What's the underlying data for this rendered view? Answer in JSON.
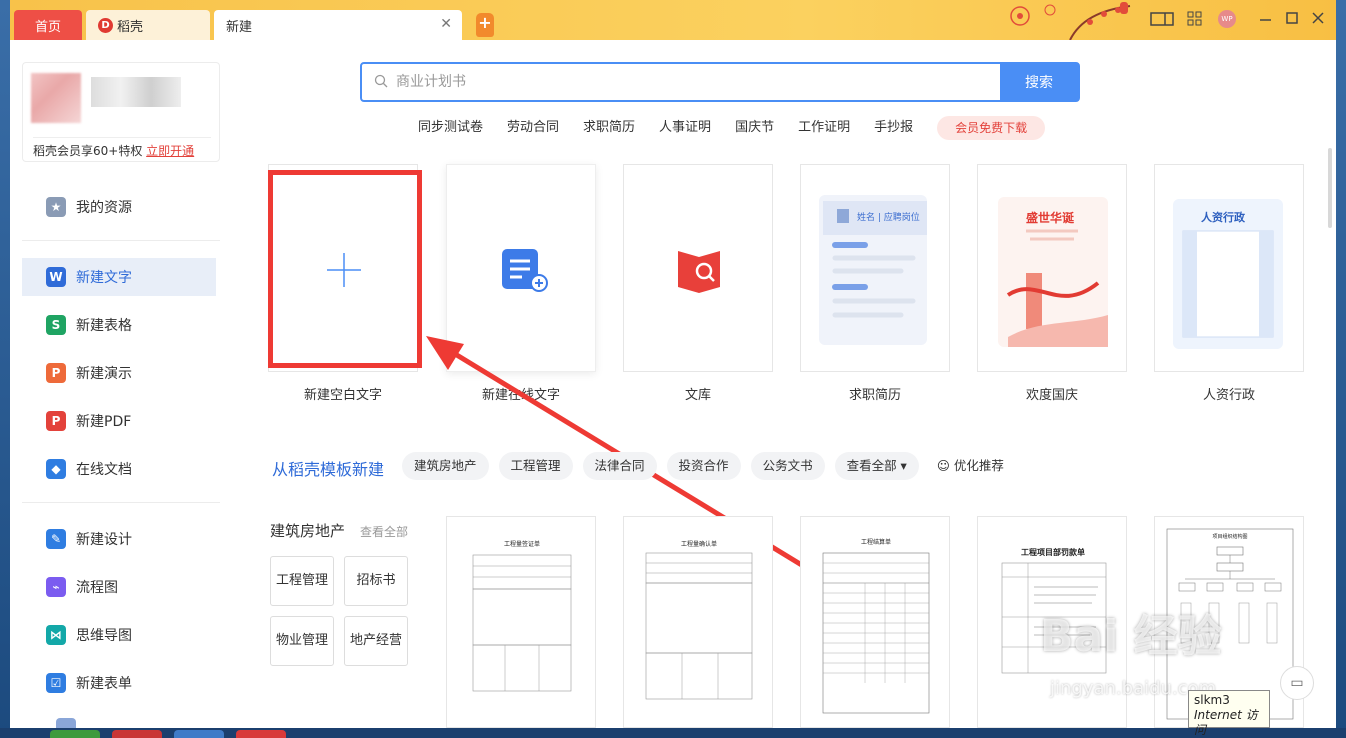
{
  "tabs": [
    {
      "label": "首页"
    },
    {
      "label": "稻壳"
    },
    {
      "label": "新建"
    }
  ],
  "user": {
    "vip_text": "稻壳会员享60+特权",
    "vip_link": "立即开通"
  },
  "sidebar": {
    "items": [
      {
        "label": "我的资源",
        "icon": "star-icon",
        "color": "#8a9bb5"
      },
      {
        "label": "新建文字",
        "icon": "writer-icon",
        "color": "#2f6bd8"
      },
      {
        "label": "新建表格",
        "icon": "sheet-icon",
        "color": "#1fa463"
      },
      {
        "label": "新建演示",
        "icon": "presentation-icon",
        "color": "#ee6a3a"
      },
      {
        "label": "新建PDF",
        "icon": "pdf-icon",
        "color": "#e3423b"
      },
      {
        "label": "在线文档",
        "icon": "cloud-doc-icon",
        "color": "#2f7de1"
      },
      {
        "label": "新建设计",
        "icon": "design-icon",
        "color": "#2f7de1"
      },
      {
        "label": "流程图",
        "icon": "flowchart-icon",
        "color": "#7b5cf0"
      },
      {
        "label": "思维导图",
        "icon": "mindmap-icon",
        "color": "#13a8a8"
      },
      {
        "label": "新建表单",
        "icon": "form-icon",
        "color": "#2f7de1"
      }
    ]
  },
  "search": {
    "placeholder": "商业计划书",
    "button": "搜索"
  },
  "hot_tags": [
    "同步测试卷",
    "劳动合同",
    "求职简历",
    "人事证明",
    "国庆节",
    "工作证明",
    "手抄报"
  ],
  "vip_download": "会员免费下载",
  "cards": [
    {
      "label": "新建空白文字"
    },
    {
      "label": "新建在线文字"
    },
    {
      "label": "文库"
    },
    {
      "label": "求职简历",
      "inner": "姓名 | 应聘岗位"
    },
    {
      "label": "欢度国庆",
      "inner": "盛世华诞"
    },
    {
      "label": "人资行政",
      "inner": "人资行政"
    }
  ],
  "templates": {
    "title": "从稻壳模板新建",
    "chips": [
      "建筑房地产",
      "工程管理",
      "法律合同",
      "投资合作",
      "公务文书",
      "查看全部 ▾"
    ],
    "optimize": "优化推荐"
  },
  "category": {
    "title": "建筑房地产",
    "more": "查看全部",
    "buttons": [
      "工程管理",
      "招标书",
      "物业管理",
      "地产经营"
    ]
  },
  "docs": [
    {
      "title": "工程量签证单"
    },
    {
      "title": "工程量确认单"
    },
    {
      "title": "工程结算单"
    },
    {
      "title": "工程项目部罚款单"
    },
    {
      "title": "项目组织结构图"
    }
  ],
  "tooltip": {
    "line1": "slkm3",
    "line2": "Internet 访问"
  },
  "watermark": {
    "main": "Bai 经验",
    "sub": "jingyan.baidu.com"
  }
}
